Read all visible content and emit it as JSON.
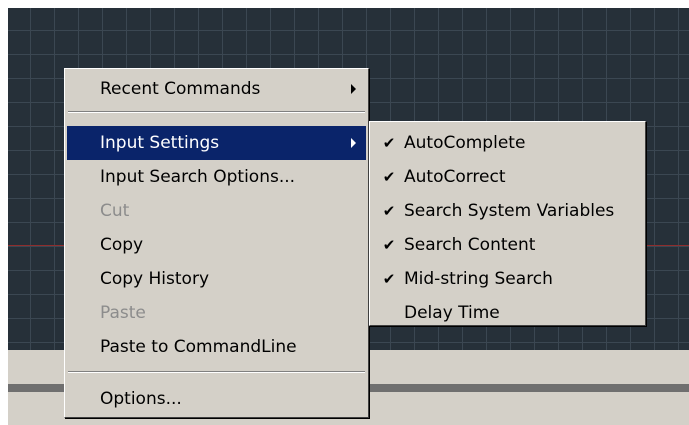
{
  "context_menu": {
    "recent_commands": "Recent Commands",
    "input_settings": "Input Settings",
    "input_search_options": "Input Search Options...",
    "cut": "Cut",
    "copy": "Copy",
    "copy_history": "Copy History",
    "paste": "Paste",
    "paste_to_commandline": "Paste to CommandLine",
    "options": "Options..."
  },
  "submenu": {
    "autocomplete": "AutoComplete",
    "autocorrect": "AutoCorrect",
    "search_system_variables": "Search System Variables",
    "search_content": "Search Content",
    "midstring_search": "Mid-string Search",
    "delay_time": "Delay Time",
    "check_glyph": "✔"
  },
  "colors": {
    "highlight": "#0a246a",
    "menu_bg": "#d4d0c8",
    "drawing_bg": "#263039"
  }
}
